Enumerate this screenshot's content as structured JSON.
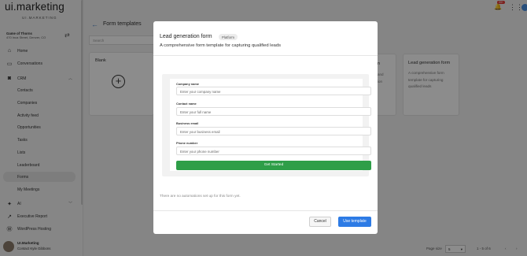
{
  "app": {
    "logo": "ui.marketing",
    "logo_sub": "UI.MARKETING",
    "company_name": "Game of Thorns",
    "company_address": "470 Inca Street, Denver, CO",
    "notification_count": "99+"
  },
  "sidebar": {
    "items": [
      {
        "label": "Home",
        "icon": "home-icon"
      },
      {
        "label": "Conversations",
        "icon": "chat-icon"
      },
      {
        "label": "CRM",
        "icon": "crm-icon"
      },
      {
        "label": "Contacts"
      },
      {
        "label": "Companies"
      },
      {
        "label": "Activity feed"
      },
      {
        "label": "Opportunities"
      },
      {
        "label": "Tasks"
      },
      {
        "label": "Lists"
      },
      {
        "label": "Leaderboard"
      },
      {
        "label": "Forms"
      },
      {
        "label": "My Meetings"
      },
      {
        "label": "AI",
        "icon": "sparkle-icon"
      },
      {
        "label": "Executive Report",
        "icon": "chart-icon"
      },
      {
        "label": "WordPress Hosting",
        "icon": "wordpress-icon"
      }
    ],
    "user": {
      "name": "UI.Marketing",
      "contact": "Contact Kyle Gibbons"
    }
  },
  "main": {
    "title": "Form templates",
    "search_placeholder": "Search",
    "blank_card": "Blank",
    "middle_card": {
      "title": "n",
      "desc_lines": [
        "",
        "and",
        "ion"
      ]
    },
    "right_card": {
      "title": "Lead generation form",
      "desc": "A comprehensive form template for capturing qualified leads"
    },
    "pager": {
      "size_label": "Page size",
      "size_value": "5",
      "range": "1 - 5 of 6"
    }
  },
  "modal": {
    "title": "Lead generation form",
    "tag": "Platform",
    "description": "A comprehensive form template for capturing qualified leads",
    "fields": [
      {
        "label": "Company name",
        "placeholder": "Enter your company name"
      },
      {
        "label": "Contact name",
        "placeholder": "Enter your full name"
      },
      {
        "label": "Business email",
        "placeholder": "Enter your business email"
      },
      {
        "label": "Phone number",
        "placeholder": "Enter your phone number"
      }
    ],
    "submit_label": "Get Started",
    "automations_note": "There are no automations set up for this form yet.",
    "cancel_label": "Cancel",
    "use_label": "Use template"
  },
  "colors": {
    "primary": "#2d7be5",
    "success": "#2e9e48",
    "badge": "#e53935"
  }
}
